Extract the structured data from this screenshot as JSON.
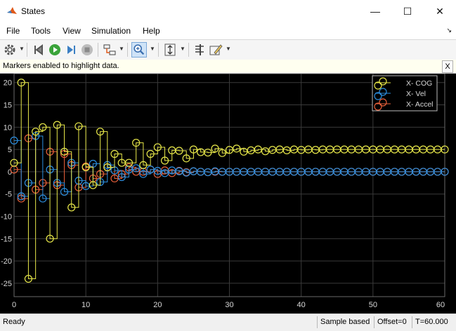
{
  "window": {
    "title": "States",
    "minimize_icon": "minimize-icon",
    "maximize_icon": "maximize-icon",
    "close_icon": "close-icon"
  },
  "menu": {
    "items": [
      "File",
      "Tools",
      "View",
      "Simulation",
      "Help"
    ]
  },
  "toolbar": {
    "icons": [
      "gear-icon",
      "step-back-icon",
      "run-icon",
      "step-forward-icon",
      "stop-icon",
      "highlight-signal-icon",
      "zoom-icon",
      "autoscale-icon",
      "cursor-measure-icon",
      "edit-style-icon"
    ]
  },
  "infobar": {
    "message": "Markers enabled to highlight data.",
    "close_label": "X"
  },
  "status": {
    "ready": "Ready",
    "mode": "Sample based",
    "offset": "Offset=0",
    "time": "T=60.000"
  },
  "colors": {
    "cog": "#e8e84a",
    "vel": "#2d8fe0",
    "accel": "#e8603a",
    "plot_bg": "#000000",
    "grid": "#3a3a3a"
  },
  "chart_data": {
    "type": "line",
    "style": "stairs with circle markers",
    "xlim": [
      0,
      60
    ],
    "ylim": [
      -28,
      22
    ],
    "xticks": [
      0,
      10,
      20,
      30,
      40,
      50,
      60
    ],
    "yticks": [
      20,
      15,
      10,
      5,
      0,
      -5,
      -10,
      -15,
      -20,
      -25
    ],
    "grid": true,
    "legend_position": "top-right",
    "series": [
      {
        "name": "X- COG",
        "color": "#e8e84a",
        "values": [
          2,
          20,
          -24,
          9,
          10,
          -15,
          10.5,
          4.5,
          -8,
          10.2,
          1,
          -3,
          9,
          1,
          4,
          2,
          2,
          6.5,
          1.5,
          4,
          5.5,
          2.5,
          4.8,
          4.7,
          3,
          5,
          4.4,
          4.3,
          5.2,
          4.2,
          4.9,
          5.2,
          4.5,
          4.8,
          5,
          4.6,
          4.9,
          5,
          4.8,
          5,
          4.9,
          5,
          4.9,
          5,
          5,
          5,
          5,
          5,
          5,
          5,
          5,
          5,
          5,
          5,
          5,
          5,
          5,
          5,
          5,
          5,
          5
        ]
      },
      {
        "name": "X- Vel",
        "color": "#2d8fe0",
        "values": [
          7,
          -5.5,
          -2.5,
          8,
          -6,
          0.5,
          -2.5,
          -4.5,
          2,
          -2,
          -3.2,
          1.8,
          -2.3,
          1.5,
          0.3,
          -1.2,
          0.5,
          0.8,
          -0.5,
          0.5,
          0.2,
          -0.3,
          0.3,
          0.1,
          -0.2,
          0.1,
          0,
          -0.1,
          0.1,
          0,
          0,
          0,
          0,
          0,
          0,
          0,
          0,
          0,
          0,
          0,
          0,
          0,
          0,
          0,
          0,
          0,
          0,
          0,
          0,
          0,
          0,
          0,
          0,
          0,
          0,
          0,
          0,
          0,
          0,
          0,
          0
        ]
      },
      {
        "name": "X- Accel",
        "color": "#e8603a",
        "values": [
          0.5,
          -6,
          7.5,
          -4,
          -2.5,
          4.5,
          -3,
          4,
          1.5,
          -3.5,
          1.2,
          -1.5,
          -0.5,
          1,
          -1.5,
          -0.5,
          1,
          0,
          0,
          0.5,
          -0.5,
          0.3,
          -0.3,
          0.2,
          -0.1,
          0.1,
          0,
          -0.1,
          0,
          0,
          0,
          0,
          0,
          0,
          0,
          0,
          0,
          0,
          0,
          0,
          0,
          0,
          0,
          0,
          0,
          0,
          0,
          0,
          0,
          0,
          0,
          0,
          0,
          0,
          0,
          0,
          0,
          0,
          0,
          0,
          0
        ]
      }
    ]
  }
}
